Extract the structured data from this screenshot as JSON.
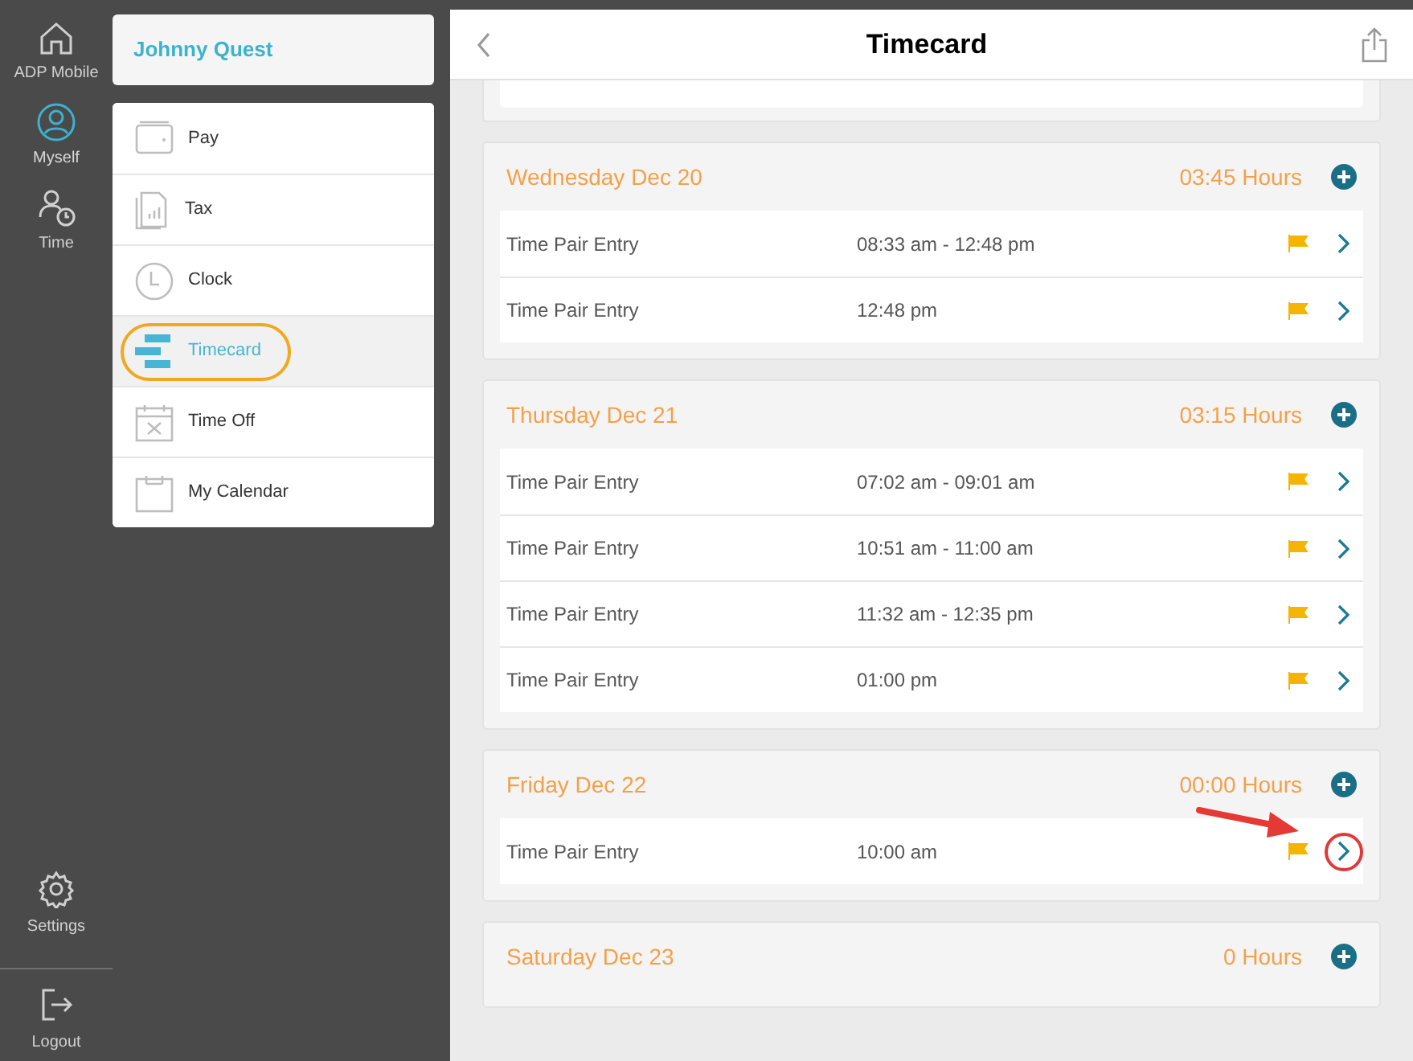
{
  "rail": {
    "items": [
      {
        "label": "ADP Mobile",
        "selected": false
      },
      {
        "label": "Myself",
        "selected": true
      },
      {
        "label": "Time",
        "selected": false
      }
    ],
    "bottom": [
      {
        "label": "Settings"
      },
      {
        "label": "Logout"
      }
    ]
  },
  "menu": {
    "user": "Johnny Quest",
    "items": [
      {
        "label": "Pay",
        "selected": false,
        "circled": false
      },
      {
        "label": "Tax",
        "selected": false,
        "circled": false
      },
      {
        "label": "Clock",
        "selected": false,
        "circled": false
      },
      {
        "label": "Timecard",
        "selected": true,
        "circled": true
      },
      {
        "label": "Time Off",
        "selected": false,
        "circled": false
      },
      {
        "label": "My Calendar",
        "selected": false,
        "circled": false
      }
    ]
  },
  "header": {
    "title": "Timecard"
  },
  "days": [
    {
      "date": "Wednesday Dec 20",
      "hours": "03:45 Hours",
      "entries": [
        {
          "label": "Time Pair Entry",
          "time": "08:33 am - 12:48 pm",
          "flagged": true,
          "annotated": false
        },
        {
          "label": "Time Pair Entry",
          "time": "12:48 pm",
          "flagged": true,
          "annotated": false
        }
      ]
    },
    {
      "date": "Thursday Dec 21",
      "hours": "03:15 Hours",
      "entries": [
        {
          "label": "Time Pair Entry",
          "time": "07:02 am - 09:01 am",
          "flagged": true,
          "annotated": false
        },
        {
          "label": "Time Pair Entry",
          "time": "10:51 am - 11:00 am",
          "flagged": true,
          "annotated": false
        },
        {
          "label": "Time Pair Entry",
          "time": "11:32 am - 12:35 pm",
          "flagged": true,
          "annotated": false
        },
        {
          "label": "Time Pair Entry",
          "time": "01:00 pm",
          "flagged": true,
          "annotated": false
        }
      ]
    },
    {
      "date": "Friday Dec 22",
      "hours": "00:00 Hours",
      "entries": [
        {
          "label": "Time Pair Entry",
          "time": "10:00 am",
          "flagged": true,
          "annotated": true
        }
      ]
    },
    {
      "date": "Saturday Dec 23",
      "hours": "0 Hours"
    }
  ]
}
